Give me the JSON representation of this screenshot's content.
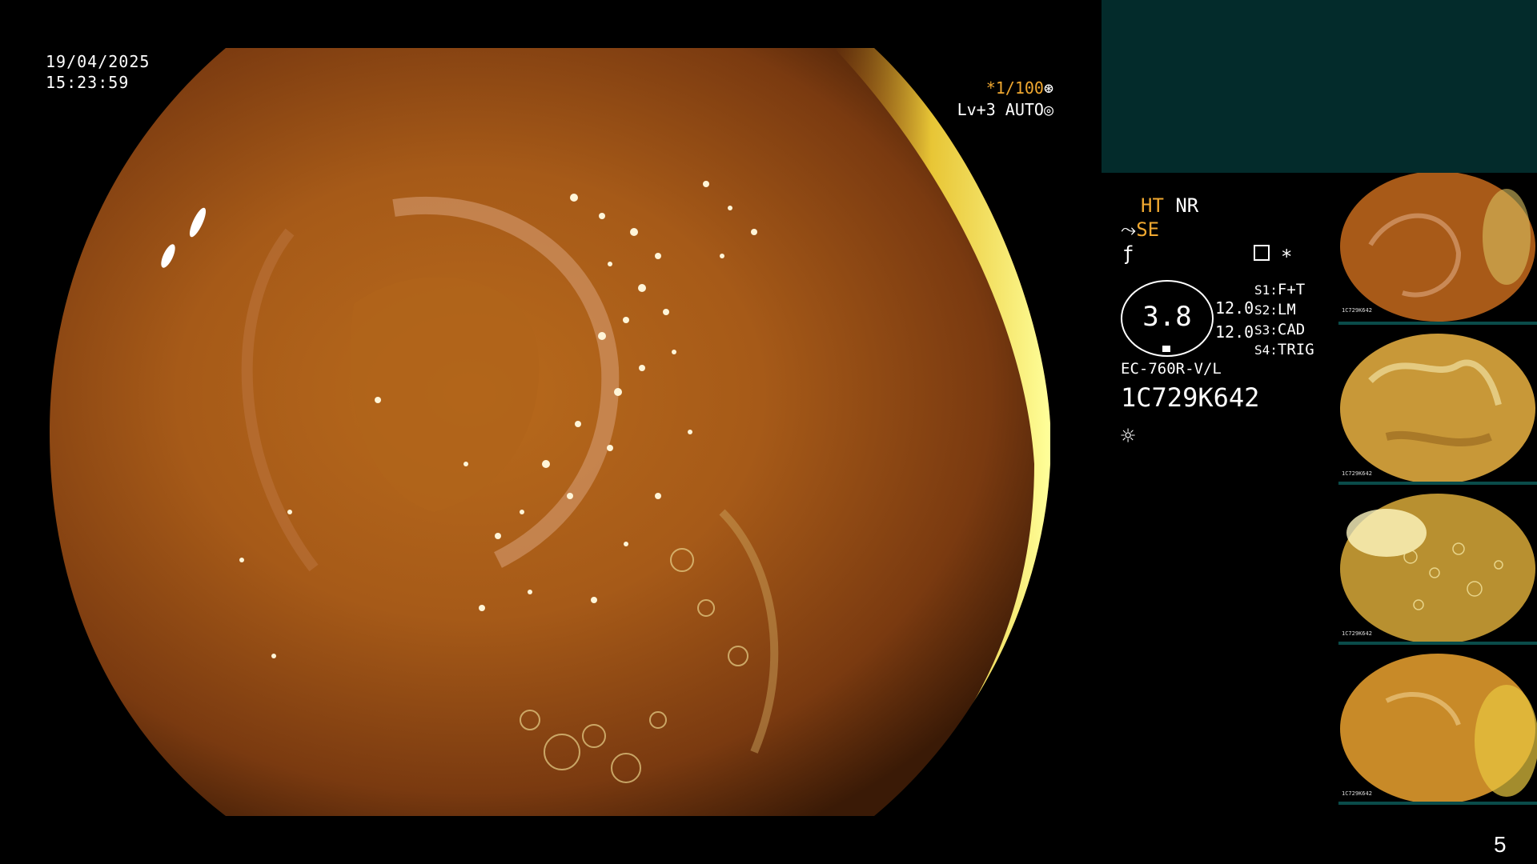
{
  "main": {
    "date": "19/04/2025",
    "time": "15:23:59",
    "shutter": "*1/100",
    "level": "Lv+3 AUTO"
  },
  "panel": {
    "ht": "HT",
    "nr": "NR",
    "se": "SE",
    "gauge_value": "3.8",
    "val_top": "12.0",
    "val_bottom": "12.0",
    "s1_key": "S1:",
    "s1_val": "F+T",
    "s2_key": "S2:",
    "s2_val": "LM",
    "s3_key": "S3:",
    "s3_val": "CAD",
    "s4_key": "S4:",
    "s4_val": "TRIG",
    "model": "EC-760R-V/L",
    "serial": "1C729K642",
    "asterisk": "*"
  },
  "thumbnails": [
    {
      "label": "1C729K642",
      "tone": "orange"
    },
    {
      "label": "1C729K642",
      "tone": "yellow-folds"
    },
    {
      "label": "1C729K642",
      "tone": "bubbles"
    },
    {
      "label": "1C729K642",
      "tone": "yellow"
    }
  ],
  "page_number": "5",
  "colors": {
    "accent": "#f0a830",
    "panel_teal": "#032b2b",
    "thumb_bar": "#0a4c4a"
  }
}
